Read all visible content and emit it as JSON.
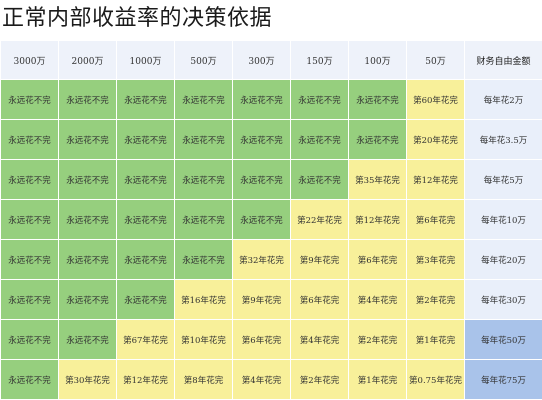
{
  "title": "正常内部收益率的决策依据",
  "columns": [
    "3000万",
    "2000万",
    "1000万",
    "500万",
    "300万",
    "150万",
    "100万",
    "50万",
    "财务自由金额"
  ],
  "rows": [
    {
      "label": "每年花2万",
      "cells": [
        "永远花不完",
        "永远花不完",
        "永远花不完",
        "永远花不完",
        "永远花不完",
        "永远花不完",
        "永远花不完",
        "第60年花完"
      ]
    },
    {
      "label": "每年花3.5万",
      "cells": [
        "永远花不完",
        "永远花不完",
        "永远花不完",
        "永远花不完",
        "永远花不完",
        "永远花不完",
        "永远花不完",
        "第20年花完"
      ]
    },
    {
      "label": "每年花5万",
      "cells": [
        "永远花不完",
        "永远花不完",
        "永远花不完",
        "永远花不完",
        "永远花不完",
        "永远花不完",
        "第35年花完",
        "第12年花完"
      ]
    },
    {
      "label": "每年花10万",
      "cells": [
        "永远花不完",
        "永远花不完",
        "永远花不完",
        "永远花不完",
        "永远花不完",
        "第22年花完",
        "第12年花完",
        "第6年花完"
      ]
    },
    {
      "label": "每年花20万",
      "cells": [
        "永远花不完",
        "永远花不完",
        "永远花不完",
        "永远花不完",
        "第32年花完",
        "第9年花完",
        "第6年花完",
        "第3年花完"
      ]
    },
    {
      "label": "每年花30万",
      "cells": [
        "永远花不完",
        "永远花不完",
        "永远花不完",
        "第16年花完",
        "第9年花完",
        "第6年花完",
        "第4年花完",
        "第2年花完"
      ]
    },
    {
      "label": "每年花50万",
      "cells": [
        "永远花不完",
        "永远花不完",
        "第67年花完",
        "第10年花完",
        "第6年花完",
        "第4年花完",
        "第2年花完",
        "第1年花完"
      ]
    },
    {
      "label": "每年花75万",
      "cells": [
        "永远花不完",
        "第30年花完",
        "第12年花完",
        "第8年花完",
        "第4年花完",
        "第2年花完",
        "第1年花完",
        "第0.75年花完"
      ]
    }
  ],
  "colors": {
    "green": "#96cf7e",
    "yellow": "#f8f09a",
    "header": "#eef2fa",
    "blue": "#a9c3ea"
  }
}
